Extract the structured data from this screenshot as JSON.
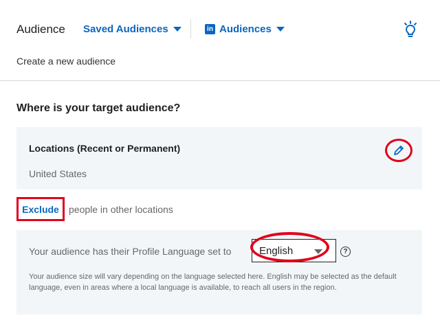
{
  "header": {
    "title": "Audience",
    "saved_audiences": "Saved Audiences",
    "audiences": "Audiences",
    "linkedin_icon_text": "in",
    "create_new": "Create a new audience"
  },
  "location": {
    "question": "Where is your target audience?",
    "label": "Locations (Recent or Permanent)",
    "value": "United States",
    "exclude": "Exclude",
    "exclude_rest": "people in other locations"
  },
  "language": {
    "label": "Your audience has their Profile Language set to",
    "selected": "English",
    "help_glyph": "?",
    "note": "Your audience size will vary depending on the language selected here. English may be selected as the default language, even in areas where a local language is available, to reach all users in the region."
  },
  "colors": {
    "accent": "#0a66c2",
    "highlight": "#e0001b",
    "panel": "#f3f6f8"
  }
}
